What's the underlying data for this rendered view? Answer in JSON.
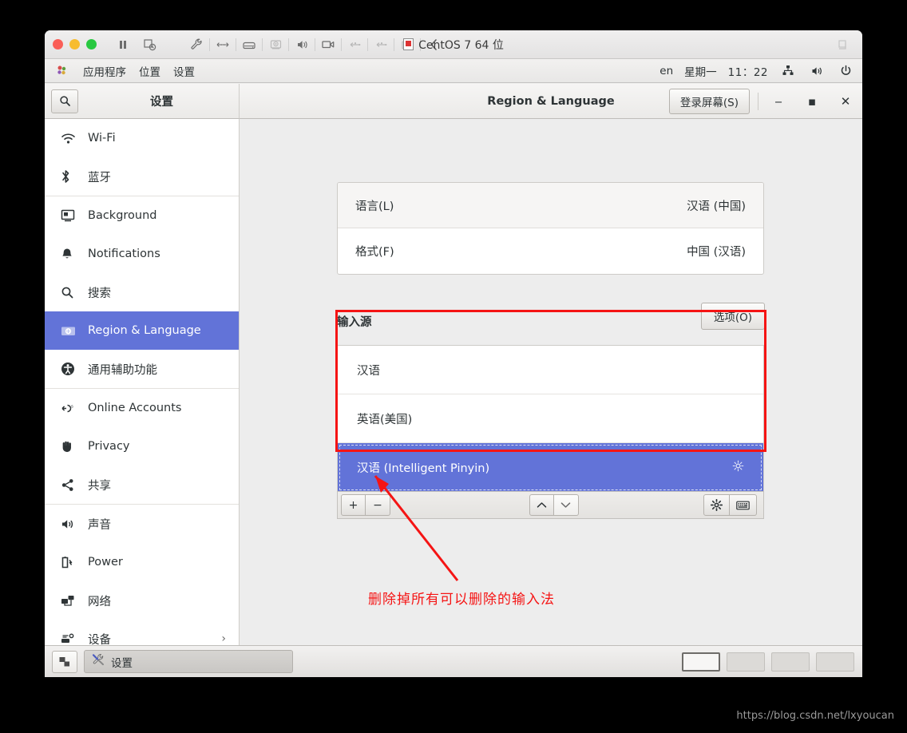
{
  "host": {
    "title": "CentOS 7 64 位",
    "toolbar_icons": [
      "wrench-icon",
      "network-icon",
      "harddisk-icon",
      "webcam-icon",
      "audio-icon",
      "video-capture-icon",
      "usb-icon",
      "usb-icon-2",
      "shared-folder-icon",
      "back-chevron-icon"
    ],
    "window_controls": [
      "close",
      "minimize",
      "zoom"
    ],
    "pause_icon": "pause-icon",
    "snapshot_icon": "snapshot-icon",
    "restore_icon": "restore-window-icon"
  },
  "gnome_topbar": {
    "menus": [
      "应用程序",
      "位置",
      "设置"
    ],
    "keyboard_layout": "en",
    "day": "星期一",
    "time": "11：22",
    "tray_icons": [
      "network-icon",
      "volume-icon",
      "power-icon"
    ]
  },
  "settings": {
    "sidebar_title": "设置",
    "search_icon": "search-icon",
    "page_title": "Region & Language",
    "login_screen_button": "登录屏幕(S)",
    "window_buttons": {
      "minimize": "‒",
      "maximize": "▪",
      "close": "✕"
    },
    "sidebar_items": [
      {
        "label": "Wi-Fi",
        "icon": "wifi-icon",
        "selected": false,
        "sep_after": false
      },
      {
        "label": "蓝牙",
        "icon": "bluetooth-icon",
        "selected": false,
        "sep_after": true
      },
      {
        "label": "Background",
        "icon": "background-icon",
        "selected": false,
        "sep_after": false
      },
      {
        "label": "Notifications",
        "icon": "bell-icon",
        "selected": false,
        "sep_after": false
      },
      {
        "label": "搜索",
        "icon": "search-icon",
        "selected": false,
        "sep_after": false
      },
      {
        "label": "Region & Language",
        "icon": "region-language-icon",
        "selected": true,
        "sep_after": false
      },
      {
        "label": "通用辅助功能",
        "icon": "accessibility-icon",
        "selected": false,
        "sep_after": true
      },
      {
        "label": "Online Accounts",
        "icon": "online-accounts-icon",
        "selected": false,
        "sep_after": false
      },
      {
        "label": "Privacy",
        "icon": "privacy-hand-icon",
        "selected": false,
        "sep_after": false
      },
      {
        "label": "共享",
        "icon": "share-icon",
        "selected": false,
        "sep_after": true
      },
      {
        "label": "声音",
        "icon": "sound-icon",
        "selected": false,
        "sep_after": false
      },
      {
        "label": "Power",
        "icon": "power-battery-icon",
        "selected": false,
        "sep_after": false
      },
      {
        "label": "网络",
        "icon": "network-devices-icon",
        "selected": false,
        "sep_after": false
      },
      {
        "label": "设备",
        "icon": "devices-icon",
        "selected": false,
        "sep_after": false,
        "chevron": "›"
      }
    ]
  },
  "region_panel": {
    "rows": [
      {
        "label": "语言(L)",
        "value": "汉语 (中国)"
      },
      {
        "label": "格式(F)",
        "value": "中国 (汉语)"
      }
    ],
    "input_sources_label": "输入源",
    "options_button": "选项(O)",
    "sources": [
      {
        "label": "汉语",
        "selected": false,
        "has_gear": false
      },
      {
        "label": "英语(美国)",
        "selected": false,
        "has_gear": false
      },
      {
        "label": "汉语 (Intelligent Pinyin)",
        "selected": true,
        "has_gear": true
      }
    ],
    "toolbar": {
      "add": "+",
      "remove": "−",
      "move_up": "⌃",
      "move_down": "⌄",
      "preferences_icon": "gear-icon",
      "keyboard_icon": "keyboard-icon"
    }
  },
  "annotation": {
    "text": "删除掉所有可以删除的输入法",
    "color": "#f51414"
  },
  "taskbar": {
    "show_desktop_icon": "show-desktop-icon",
    "window_title": "设置",
    "window_icon": "settings-tools-icon",
    "workspaces": [
      {
        "active": true
      },
      {
        "active": false
      },
      {
        "active": false
      },
      {
        "active": false
      }
    ]
  },
  "watermark": "https://blog.csdn.net/lxyoucan",
  "colors": {
    "selection_blue": "#6273d8",
    "annotation_red": "#f51414"
  }
}
